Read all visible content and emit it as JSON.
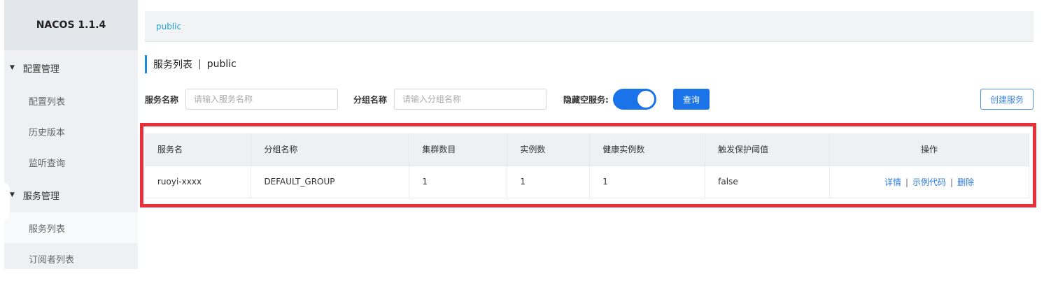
{
  "sidebar": {
    "brand": "NACOS 1.1.4",
    "groups": [
      {
        "label": "配置管理",
        "items": [
          {
            "label": "配置列表"
          },
          {
            "label": "历史版本"
          },
          {
            "label": "监听查询"
          }
        ]
      },
      {
        "label": "服务管理",
        "items": [
          {
            "label": "服务列表"
          },
          {
            "label": "订阅者列表"
          }
        ]
      }
    ]
  },
  "namespace_bar": {
    "current": "public"
  },
  "page": {
    "title": "服务列表",
    "separator": "|",
    "namespace": "public"
  },
  "filters": {
    "service_name_label": "服务名称",
    "service_name_placeholder": "请输入服务名称",
    "group_name_label": "分组名称",
    "group_name_placeholder": "请输入分组名称",
    "hide_empty_label": "隐藏空服务:",
    "hide_empty_on": true,
    "query_button": "查询",
    "create_button": "创建服务"
  },
  "table": {
    "columns": [
      "服务名",
      "分组名称",
      "集群数目",
      "实例数",
      "健康实例数",
      "触发保护阈值",
      "操作"
    ],
    "rows": [
      {
        "service_name": "ruoyi-xxxx",
        "group_name": "DEFAULT_GROUP",
        "cluster_count": "1",
        "instance_count": "1",
        "healthy_count": "1",
        "protect_threshold": "false"
      }
    ],
    "actions": {
      "detail": "详情",
      "sample_code": "示例代码",
      "delete": "删除",
      "separator": "|"
    }
  },
  "colors": {
    "accent": "#1a73e8",
    "highlight_border": "#e8303a",
    "link": "#2a7ae0"
  }
}
